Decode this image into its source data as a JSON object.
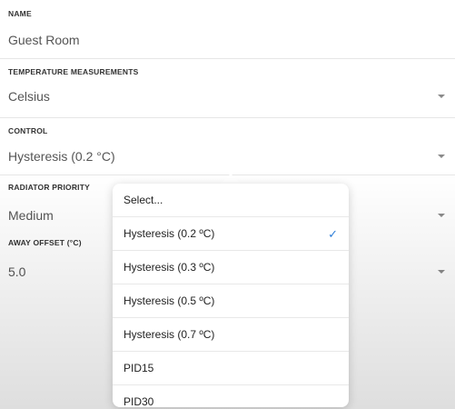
{
  "form": {
    "name": {
      "label": "NAME",
      "value": "Guest Room"
    },
    "temperature": {
      "label": "TEMPERATURE MEASUREMENTS",
      "value": "Celsius"
    },
    "control": {
      "label": "CONTROL",
      "value": "Hysteresis (0.2 °C)"
    },
    "radiator_priority": {
      "label": "RADIATOR PRIORITY",
      "value": "Medium"
    },
    "away_offset": {
      "label": "AWAY OFFSET (°C)",
      "value": "5.0"
    }
  },
  "dropdown": {
    "options": [
      {
        "label": "Select...",
        "selected": false
      },
      {
        "label": "Hysteresis (0.2 ºC)",
        "selected": true
      },
      {
        "label": "Hysteresis (0.3 ºC)",
        "selected": false
      },
      {
        "label": "Hysteresis (0.5 ºC)",
        "selected": false
      },
      {
        "label": "Hysteresis (0.7 ºC)",
        "selected": false
      },
      {
        "label": "PID15",
        "selected": false
      },
      {
        "label": "PID30",
        "selected": false
      }
    ],
    "check_icon": "checkmark-icon",
    "accent_color": "#2f7fd8"
  }
}
